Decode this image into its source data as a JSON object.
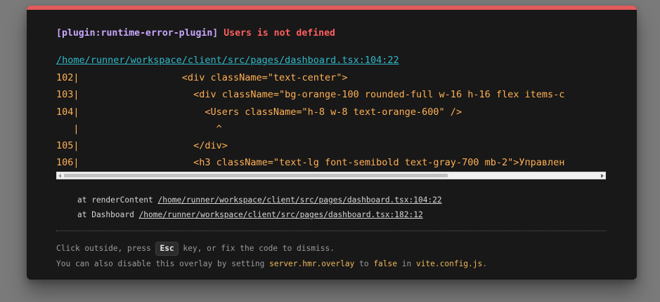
{
  "error": {
    "plugin": "[plugin:runtime-error-plugin]",
    "message": "Users is not defined",
    "file_link": "/home/runner/workspace/client/src/pages/dashboard.tsx:104:22"
  },
  "code_frame": {
    "lines": [
      "102|                  <div className=\"text-center\">",
      "103|                    <div className=\"bg-orange-100 rounded-full w-16 h-16 flex items-c",
      "104|                      <Users className=\"h-8 w-8 text-orange-600\" />",
      "   |                        ^",
      "105|                    </div>",
      "106|                    <h3 className=\"text-lg font-semibold text-gray-700 mb-2\">Управлен"
    ]
  },
  "stack": [
    {
      "prefix": "at renderContent ",
      "location": "/home/runner/workspace/client/src/pages/dashboard.tsx:104:22"
    },
    {
      "prefix": "at Dashboard ",
      "location": "/home/runner/workspace/client/src/pages/dashboard.tsx:182:12"
    }
  ],
  "tip": {
    "line1_before": "Click outside, press ",
    "key": "Esc",
    "line1_after": " key, or fix the code to dismiss.",
    "line2_a": "You can also disable this overlay by setting ",
    "line2_b": "server.hmr.overlay",
    "line2_c": " to ",
    "line2_d": "false",
    "line2_e": " in ",
    "line2_f": "vite.config.js",
    "line2_g": "."
  },
  "colors": {
    "accent_bar": "#e45b5b",
    "plugin": "#c9a7ff",
    "message": "#ff5f5f",
    "link": "#30b8c8",
    "code": "#ffb055"
  }
}
